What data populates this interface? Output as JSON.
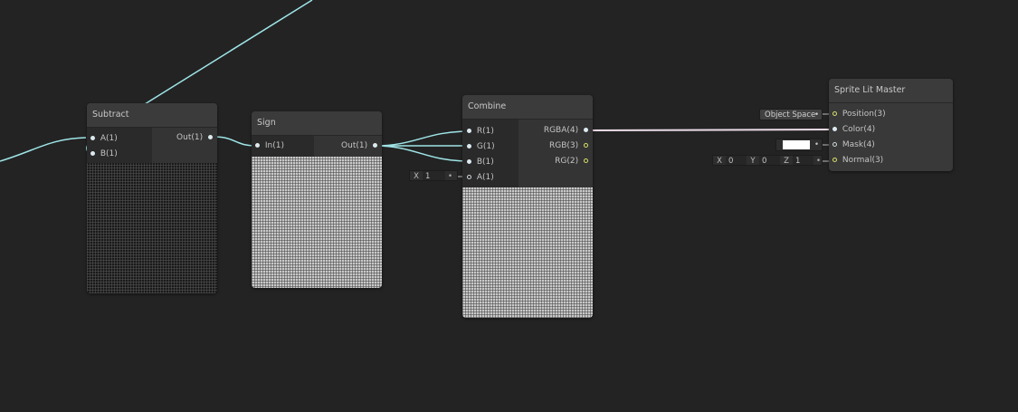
{
  "colors": {
    "background": "#232323",
    "node_body": "#393939",
    "wire_vector1": "#9fe5e8",
    "wire_vector4": "#e8dce6",
    "port_vector2": "#d8e06a"
  },
  "nodes": {
    "subtract": {
      "title": "Subtract",
      "inputs": [
        "A(1)",
        "B(1)"
      ],
      "outputs": [
        "Out(1)"
      ]
    },
    "sign": {
      "title": "Sign",
      "inputs": [
        "In(1)"
      ],
      "outputs": [
        "Out(1)"
      ]
    },
    "combine": {
      "title": "Combine",
      "inputs": [
        "R(1)",
        "G(1)",
        "B(1)",
        "A(1)"
      ],
      "outputs": [
        "RGBA(4)",
        "RGB(3)",
        "RG(2)"
      ],
      "a_default": {
        "label": "X",
        "value": "1"
      }
    },
    "sprite_lit_master": {
      "title": "Sprite Lit Master",
      "inputs": [
        "Position(3)",
        "Color(4)",
        "Mask(4)",
        "Normal(3)"
      ],
      "position_space": "Object Space",
      "mask_color": "#ffffff",
      "normal_default": [
        {
          "label": "X",
          "value": "0"
        },
        {
          "label": "Y",
          "value": "0"
        },
        {
          "label": "Z",
          "value": "1"
        }
      ]
    }
  },
  "icons": {
    "dropdown": "dropdown-arrow-icon",
    "port": "port-dot-icon"
  }
}
